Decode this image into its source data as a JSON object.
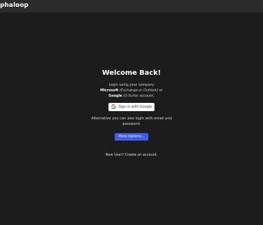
{
  "header": {
    "brand": "phaloop"
  },
  "login": {
    "title": "Welcome Back!",
    "line1": "Login using your company",
    "microsoft": "Microsoft",
    "microsoft_note": "(Exchange or Outlook)",
    "or": "or",
    "google": "Google",
    "google_note": "(G-Suite)",
    "account": "account.",
    "google_button": "Sign in with Google",
    "alt_text": "Alternative you can also login with email and password.",
    "more_button": "More Options...",
    "new_user_prefix": "New User?",
    "create_account": "Create an account."
  },
  "colors": {
    "background": "#1c1c1c",
    "topbar": "#2b2b2b",
    "accent": "#3f5bf3"
  },
  "icons": {
    "google": "google-g-icon"
  }
}
